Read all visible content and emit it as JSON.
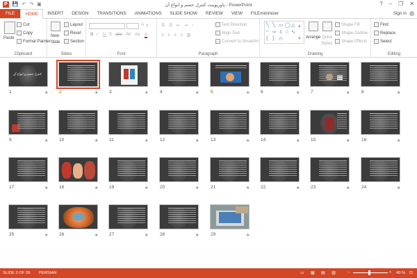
{
  "window": {
    "title": "پاورپوینت کنترل خشم و انواع آن - PowerPoint",
    "help": "?",
    "minimize": "–",
    "restore": "❐",
    "close": "✕"
  },
  "qat": {
    "save": "💾",
    "undo": "↶",
    "redo": "↷",
    "present": "▣"
  },
  "tabs": [
    {
      "label": "FILE",
      "kind": "file"
    },
    {
      "label": "HOME",
      "kind": "active"
    },
    {
      "label": "INSERT"
    },
    {
      "label": "DESIGN"
    },
    {
      "label": "TRANSITIONS"
    },
    {
      "label": "ANIMATIONS"
    },
    {
      "label": "SLIDE SHOW"
    },
    {
      "label": "REVIEW"
    },
    {
      "label": "VIEW"
    },
    {
      "label": "FILEminimizer"
    }
  ],
  "signin": "Sign in",
  "ribbon": {
    "clipboard": {
      "label": "Clipboard",
      "paste": "Paste",
      "cut": "Cut",
      "copy": "Copy",
      "format_painter": "Format Painter"
    },
    "slides": {
      "label": "Slides",
      "new_slide": "New",
      "new_slide2": "Slide",
      "layout": "Layout",
      "reset": "Reset",
      "section": "Section"
    },
    "font": {
      "label": "Font",
      "bold": "B",
      "italic": "I",
      "underline": "U",
      "strike": "S",
      "shadow": "abc",
      "spacing": "AV",
      "case": "Aa",
      "grow": "A",
      "shrink": "A",
      "color": "A"
    },
    "paragraph": {
      "label": "Paragraph",
      "text_direction": "Text Direction",
      "align_text": "Align Text",
      "convert": "Convert to SmartArt"
    },
    "drawing": {
      "label": "Drawing",
      "arrange": "Arrange",
      "quick_styles": "Quick",
      "quick_styles2": "Styles",
      "shape_fill": "Shape Fill",
      "shape_outline": "Shape Outline",
      "shape_effects": "Shape Effects"
    },
    "editing": {
      "label": "Editing",
      "find": "Find",
      "replace": "Replace",
      "select": "Select"
    }
  },
  "slides": [
    {
      "n": "1",
      "title": "کنترل خشم و انواع آن"
    },
    {
      "n": "2"
    },
    {
      "n": "3"
    },
    {
      "n": "4"
    },
    {
      "n": "5"
    },
    {
      "n": "6"
    },
    {
      "n": "7"
    },
    {
      "n": "8"
    },
    {
      "n": "9"
    },
    {
      "n": "10"
    },
    {
      "n": "11"
    },
    {
      "n": "12"
    },
    {
      "n": "13"
    },
    {
      "n": "14"
    },
    {
      "n": "15"
    },
    {
      "n": "16"
    },
    {
      "n": "17"
    },
    {
      "n": "18"
    },
    {
      "n": "19"
    },
    {
      "n": "20"
    },
    {
      "n": "21"
    },
    {
      "n": "22"
    },
    {
      "n": "23"
    },
    {
      "n": "24"
    },
    {
      "n": "25"
    },
    {
      "n": "26"
    },
    {
      "n": "27"
    },
    {
      "n": "28"
    },
    {
      "n": "29"
    }
  ],
  "star": "★",
  "status": {
    "slide_counter": "SLIDE 2 OF 29",
    "language": "PERSIAN",
    "zoom": "40 %",
    "zoom_minus": "–",
    "zoom_plus": "+"
  }
}
